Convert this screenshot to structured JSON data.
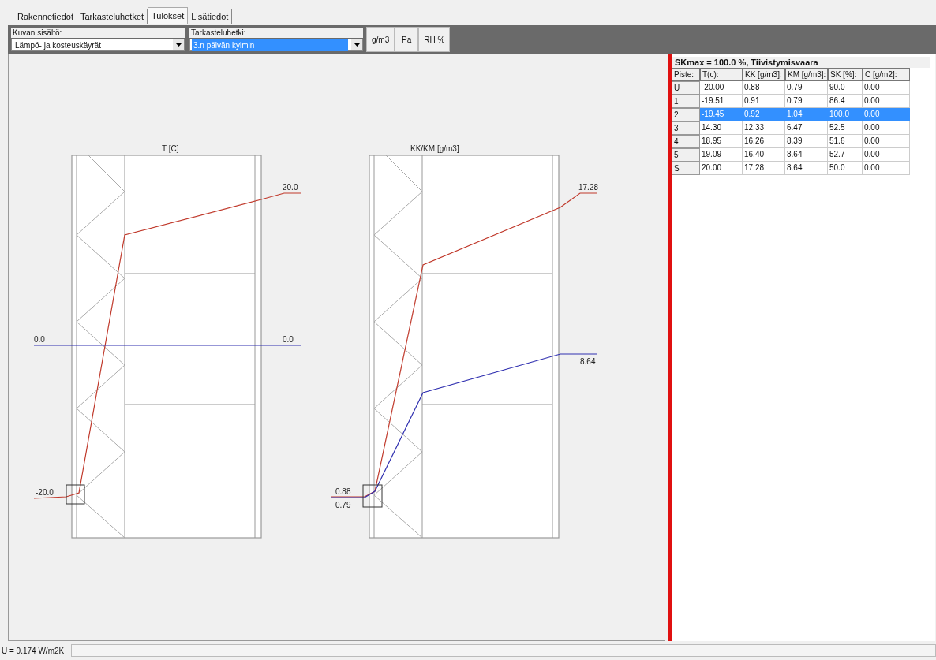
{
  "tabs": [
    {
      "label": "Rakennetiedot",
      "selected": false
    },
    {
      "label": "Tarkasteluhetket",
      "selected": false
    },
    {
      "label": "Tulokset",
      "selected": true
    },
    {
      "label": "Lisätiedot",
      "selected": false
    }
  ],
  "toolbar": {
    "fields": [
      {
        "label": "Kuvan sisältö:",
        "value": "Lämpö- ja kosteuskäyrät",
        "highlighted": false
      },
      {
        "label": "Tarkasteluhetki:",
        "value": "3.n päivän kylmin",
        "highlighted": true
      }
    ],
    "buttons": [
      "g/m3",
      "Pa",
      "RH %"
    ]
  },
  "diagrams": [
    {
      "title": "T [C]",
      "labels": [
        "20.0",
        "0.0",
        "0.0",
        "-20.0"
      ]
    },
    {
      "title": "KK/KM [g/m3]",
      "labels": [
        "17.28",
        "8.64",
        "0.88",
        "0.79"
      ]
    }
  ],
  "table": {
    "title": "SKmax = 100.0 %, Tiivistymisvaara",
    "columns": [
      "Piste:",
      "T(c):",
      "KK [g/m3]:",
      "KM [g/m3]:",
      "SK [%]:",
      "C [g/m2]:"
    ],
    "rows": [
      {
        "cells": [
          "U",
          "-20.00",
          "0.88",
          "0.79",
          "90.0",
          "0.00"
        ],
        "selected": false
      },
      {
        "cells": [
          "1",
          "-19.51",
          "0.91",
          "0.79",
          "86.4",
          "0.00"
        ],
        "selected": false
      },
      {
        "cells": [
          "2",
          "-19.45",
          "0.92",
          "1.04",
          "100.0",
          "0.00"
        ],
        "selected": true
      },
      {
        "cells": [
          "3",
          "14.30",
          "12.33",
          "6.47",
          "52.5",
          "0.00"
        ],
        "selected": false
      },
      {
        "cells": [
          "4",
          "18.95",
          "16.26",
          "8.39",
          "51.6",
          "0.00"
        ],
        "selected": false
      },
      {
        "cells": [
          "5",
          "19.09",
          "16.40",
          "8.64",
          "52.7",
          "0.00"
        ],
        "selected": false
      },
      {
        "cells": [
          "S",
          "20.00",
          "17.28",
          "8.64",
          "50.0",
          "0.00"
        ],
        "selected": false
      }
    ]
  },
  "status_bar": {
    "text": "U = 0.174 W/m2K"
  }
}
